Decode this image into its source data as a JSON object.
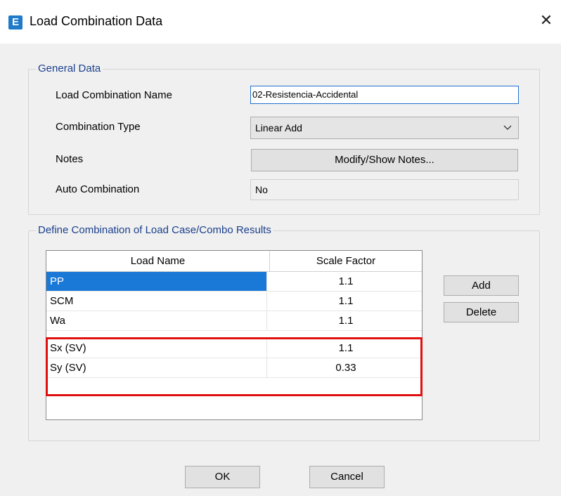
{
  "window": {
    "icon_letter": "E",
    "title": "Load Combination Data",
    "close_glyph": "✕"
  },
  "general": {
    "legend": "General Data",
    "name_label": "Load Combination Name",
    "name_value": "02-Resistencia-Accidental",
    "type_label": "Combination Type",
    "type_value": "Linear Add",
    "notes_label": "Notes",
    "notes_button": "Modify/Show Notes...",
    "auto_label": "Auto Combination",
    "auto_value": "No"
  },
  "define": {
    "legend": "Define Combination of Load Case/Combo Results",
    "columns": [
      "Load Name",
      "Scale Factor"
    ],
    "rows": [
      {
        "name": "PP",
        "factor": "1.1"
      },
      {
        "name": "SCM",
        "factor": "1.1"
      },
      {
        "name": "Wa",
        "factor": "1.1"
      },
      {
        "name": "Sx (SV)",
        "factor": "1.1"
      },
      {
        "name": "Sy (SV)",
        "factor": "0.33"
      }
    ],
    "selected_row": 0,
    "add_button": "Add",
    "delete_button": "Delete"
  },
  "footer": {
    "ok_button": "OK",
    "cancel_button": "Cancel"
  },
  "colors": {
    "selection": "#1a78d6",
    "highlight": "#e01010",
    "legend_text": "#1a3f8c"
  },
  "icons": {
    "app": "etabs-app-icon",
    "close": "close-icon",
    "dropdown": "chevron-down-icon"
  }
}
